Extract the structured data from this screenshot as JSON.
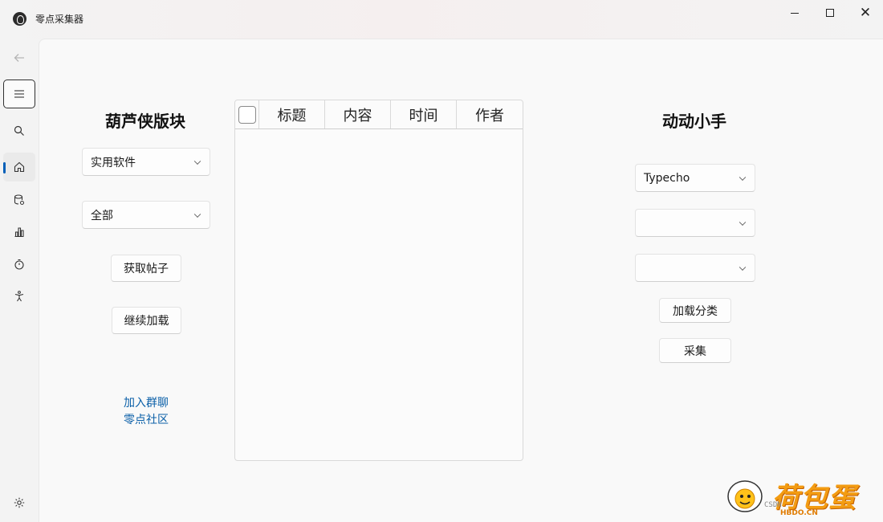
{
  "window": {
    "title": "零点采集器",
    "close_glyph": "✕"
  },
  "nav": {
    "items": [
      "back-icon",
      "menu-icon",
      "search-icon",
      "home-icon",
      "database-icon",
      "chart-icon",
      "timer-icon",
      "accessibility-icon",
      "settings-icon"
    ],
    "selected": "home",
    "accent_color": "#005fb8"
  },
  "left_panel": {
    "title": "葫芦侠版块",
    "category_combo": "实用软件",
    "filter_combo": "全部",
    "fetch_button": "获取帖子",
    "load_more_button": "继续加载",
    "join_group_link": "加入群聊",
    "community_link": "零点社区",
    "link_color": "#0a5fa8"
  },
  "table": {
    "columns": [
      "标题",
      "内容",
      "时间",
      "作者"
    ],
    "rows": []
  },
  "right_panel": {
    "title": "动动小手",
    "cms_combo": "Typecho",
    "combo2": "",
    "combo3": "",
    "load_categories_button": "加载分类",
    "collect_button": "采集"
  },
  "watermark": {
    "brand": "荷包蛋",
    "site": "HBDO.CN",
    "small": "CSDN"
  }
}
